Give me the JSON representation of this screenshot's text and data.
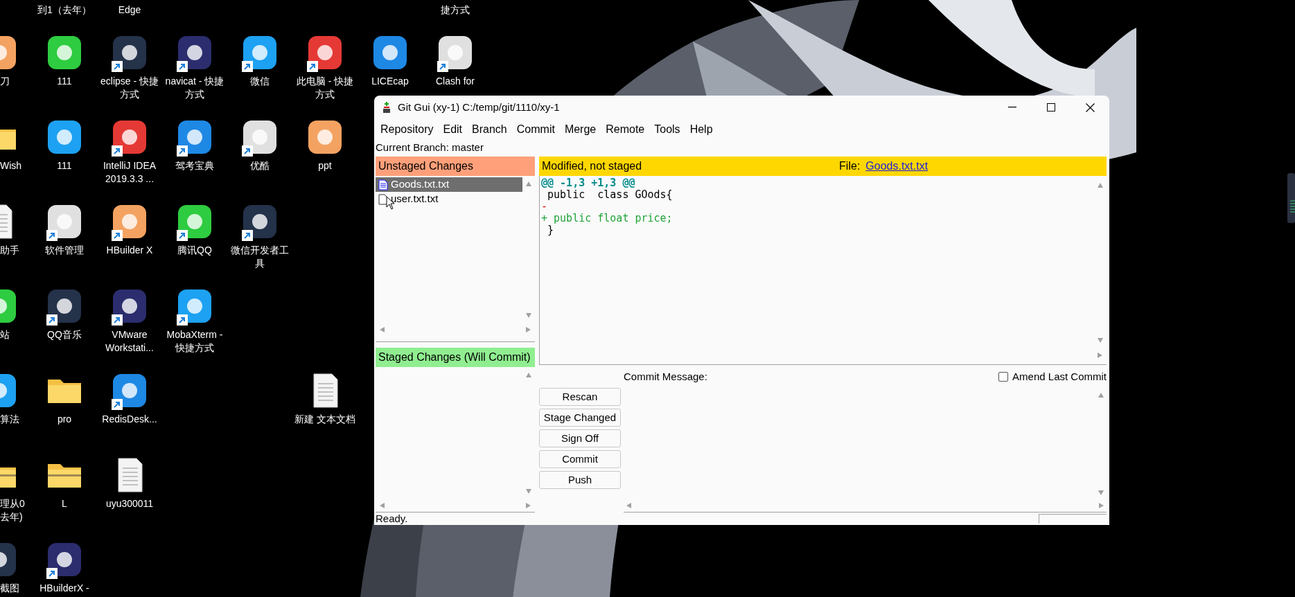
{
  "desktop": {
    "columns": [
      {
        "slots": [
          {
            "kind": "empty"
          },
          {
            "kind": "app",
            "label": "刀"
          },
          {
            "kind": "folder",
            "label": "Wish"
          },
          {
            "kind": "document",
            "label": "助手"
          },
          {
            "kind": "app",
            "label": "站"
          },
          {
            "kind": "app",
            "label": "算法"
          },
          {
            "kind": "zip",
            "label": "理从0 去年)"
          },
          {
            "kind": "app",
            "label": "截图"
          }
        ]
      },
      {
        "slots": [
          {
            "kind": "label-only",
            "label": "到1（去年）"
          },
          {
            "kind": "app",
            "label": "111",
            "shortcut": false
          },
          {
            "kind": "app",
            "label": "111",
            "shortcut": false
          },
          {
            "kind": "app",
            "label": "软件管理",
            "shortcut": true
          },
          {
            "kind": "app",
            "label": "QQ音乐",
            "shortcut": true
          },
          {
            "kind": "folder",
            "label": "pro",
            "shortcut": false
          },
          {
            "kind": "zip",
            "label": "L",
            "shortcut": false
          },
          {
            "kind": "app",
            "label": "HBuilderX -",
            "shortcut": true
          }
        ]
      },
      {
        "slots": [
          {
            "kind": "label-only",
            "label": "Edge"
          },
          {
            "kind": "app",
            "label": "eclipse - 快捷方式",
            "shortcut": true
          },
          {
            "kind": "app",
            "label": "IntelliJ IDEA 2019.3.3 ...",
            "shortcut": true
          },
          {
            "kind": "app",
            "label": "HBuilder X",
            "shortcut": true
          },
          {
            "kind": "app",
            "label": "VMware Workstati...",
            "shortcut": true
          },
          {
            "kind": "app",
            "label": "RedisDesk...",
            "shortcut": true
          },
          {
            "kind": "document",
            "label": "uyu300011",
            "shortcut": false
          }
        ]
      },
      {
        "slots": [
          {
            "kind": "empty"
          },
          {
            "kind": "app",
            "label": "navicat - 快捷方式",
            "shortcut": true
          },
          {
            "kind": "app",
            "label": "驾考宝典",
            "shortcut": true
          },
          {
            "kind": "app",
            "label": "腾讯QQ",
            "shortcut": true
          },
          {
            "kind": "app",
            "label": "MobaXterm - 快捷方式",
            "shortcut": true
          }
        ]
      },
      {
        "slots": [
          {
            "kind": "empty"
          },
          {
            "kind": "app",
            "label": "微信",
            "shortcut": true
          },
          {
            "kind": "app",
            "label": "优酷",
            "shortcut": true
          },
          {
            "kind": "app",
            "label": "微信开发者工具",
            "shortcut": true
          }
        ]
      },
      {
        "slots": [
          {
            "kind": "empty"
          },
          {
            "kind": "app",
            "label": "此电脑 - 快捷方式",
            "shortcut": true
          },
          {
            "kind": "app",
            "label": "ppt",
            "shortcut": false
          },
          {
            "kind": "empty"
          },
          {
            "kind": "empty"
          },
          {
            "kind": "document",
            "label": "新建 文本文档",
            "shortcut": false
          }
        ]
      },
      {
        "slots": [
          {
            "kind": "empty"
          },
          {
            "kind": "app",
            "label": "LICEcap",
            "shortcut": false
          }
        ]
      },
      {
        "slots": [
          {
            "kind": "label-only",
            "label": "捷方式"
          },
          {
            "kind": "app",
            "label": "Clash for",
            "shortcut": true
          }
        ]
      }
    ]
  },
  "window": {
    "title": "Git Gui (xy-1) C:/temp/git/1110/xy-1",
    "menu": [
      "Repository",
      "Edit",
      "Branch",
      "Commit",
      "Merge",
      "Remote",
      "Tools",
      "Help"
    ],
    "current_branch": "Current Branch: master",
    "unstaged": {
      "title": "Unstaged Changes",
      "files": [
        {
          "name": "Goods.txt.txt",
          "kind": "modified",
          "selected": true
        },
        {
          "name": "user.txt.txt",
          "kind": "untracked",
          "selected": false
        }
      ]
    },
    "staged": {
      "title": "Staged Changes (Will Commit)"
    },
    "diff": {
      "status": "Modified, not staged",
      "file_label": "File:",
      "file": "Goods.txt.txt",
      "lines": [
        {
          "kind": "hunk",
          "text": "@@ -1,3 +1,3 @@"
        },
        {
          "kind": "context",
          "text": " public  class GOods{"
        },
        {
          "kind": "removed",
          "text": "-"
        },
        {
          "kind": "added",
          "text": "+ public float price;"
        },
        {
          "kind": "context",
          "text": " }"
        }
      ]
    },
    "commit": {
      "label": "Commit Message:",
      "amend": {
        "label": "Amend Last Commit",
        "checked": false
      },
      "buttons": [
        "Rescan",
        "Stage Changed",
        "Sign Off",
        "Commit",
        "Push"
      ]
    },
    "status_bar": "Ready."
  }
}
